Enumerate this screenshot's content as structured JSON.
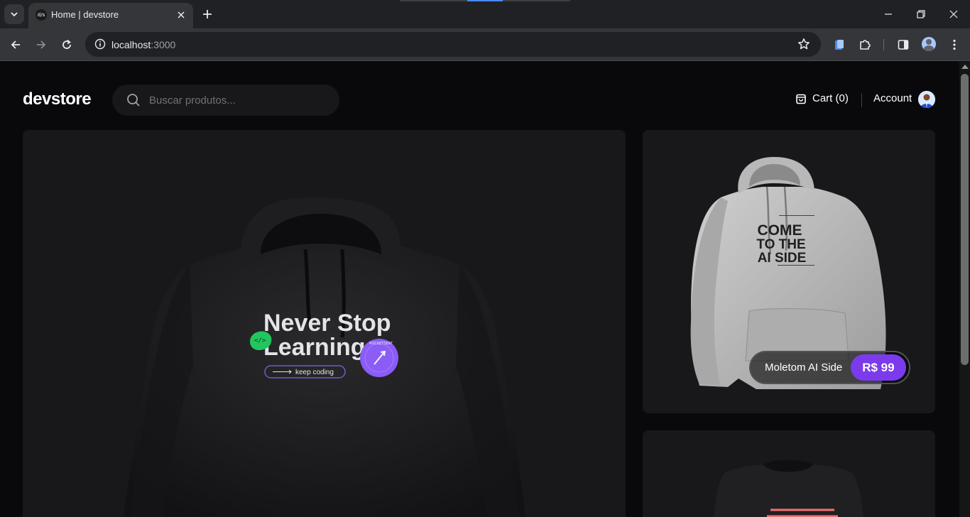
{
  "browser": {
    "tab_title": "Home | devstore",
    "favicon_text": "d/s",
    "url_host": "localhost",
    "url_port": ":3000"
  },
  "header": {
    "logo": "devstore",
    "search_placeholder": "Buscar produtos...",
    "cart_label": "Cart (0)",
    "account_label": "Account"
  },
  "products": {
    "featured": {
      "graphic_title_line1": "Never Stop",
      "graphic_title_line2": "Learning",
      "graphic_tagline": "keep coding",
      "badge_text": "ROCKETSEAT"
    },
    "side": [
      {
        "name": "Moletom AI Side",
        "price": "R$ 99",
        "graphic_lines": [
          "COME",
          "TO THE",
          "AI SIDE"
        ]
      },
      {
        "name": "",
        "price": ""
      }
    ]
  },
  "colors": {
    "page_bg": "#09090b",
    "card_bg": "#18181b",
    "accent": "#7c3aed",
    "badge_green": "#22c55e"
  }
}
